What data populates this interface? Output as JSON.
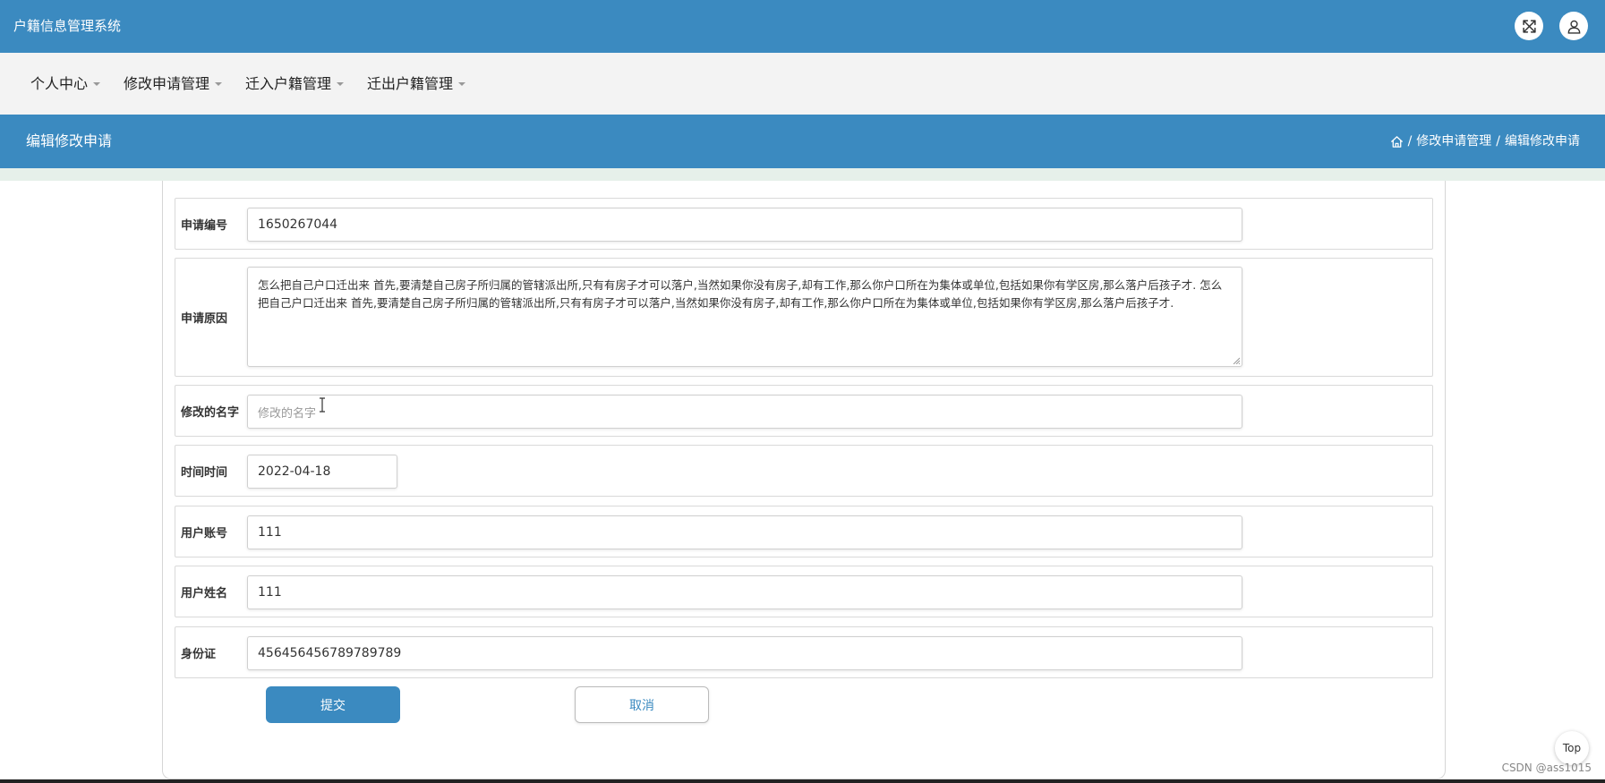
{
  "app": {
    "title": "户籍信息管理系统"
  },
  "header_icons": {
    "fullscreen": "fullscreen-icon",
    "user": "user-icon"
  },
  "nav": {
    "items": [
      "个人中心",
      "修改申请管理",
      "迁入户籍管理",
      "迁出户籍管理"
    ]
  },
  "page": {
    "title": "编辑修改申请"
  },
  "breadcrumb": {
    "home_icon": "home-icon",
    "separator": "/",
    "section": "修改申请管理",
    "current": "编辑修改申请"
  },
  "form": {
    "application_no": {
      "label": "申请编号",
      "value": "1650267044"
    },
    "reason": {
      "label": "申请原因",
      "value": " 怎么把自己户口迁出来 首先,要清楚自己房子所归属的管辖派出所,只有有房子才可以落户,当然如果你没有房子,却有工作,那么你户口所在为集体或单位,包括如果你有学区房,那么落户后孩子才. 怎么把自己户口迁出来 首先,要清楚自己房子所归属的管辖派出所,只有有房子才可以落户,当然如果你没有房子,却有工作,那么你户口所在为集体或单位,包括如果你有学区房,那么落户后孩子才."
    },
    "new_name": {
      "label": "修改的名字",
      "value": "",
      "placeholder": "修改的名字"
    },
    "time": {
      "label": "时间时间",
      "value": "2022-04-18"
    },
    "user_account": {
      "label": "用户账号",
      "value": "111"
    },
    "user_name": {
      "label": "用户姓名",
      "value": "111"
    },
    "id_card": {
      "label": "身份证",
      "value": "456456456789789789"
    }
  },
  "buttons": {
    "submit": "提交",
    "cancel": "取消"
  },
  "top_button": "Top",
  "watermark": "CSDN @ass1015",
  "colors": {
    "primary": "#3b8ac0",
    "nav_bg": "#f3f3f3",
    "strip": "#e6f0ea"
  }
}
